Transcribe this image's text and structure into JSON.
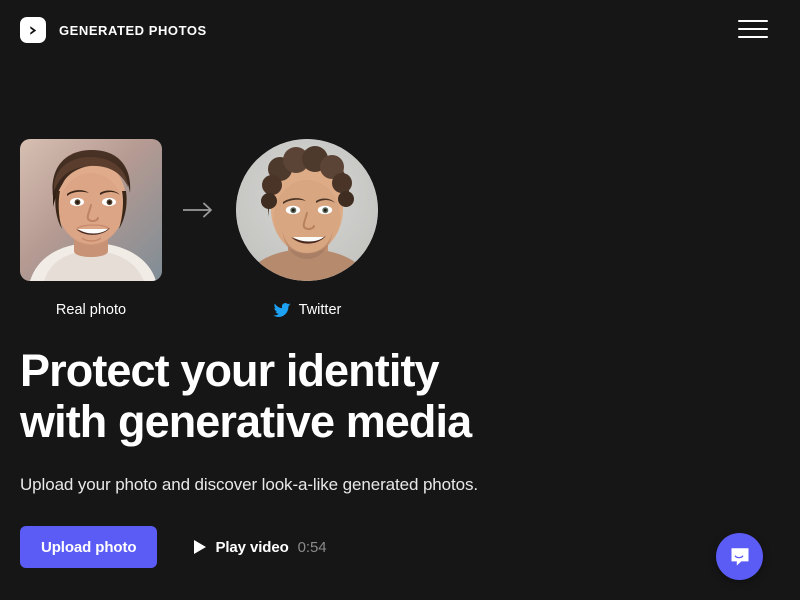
{
  "page": {
    "background_color": "#161616",
    "accent_color": "#5b5bf5",
    "twitter_color": "#1da1f2"
  },
  "header": {
    "logo_icon": "chevron-right-logo-icon",
    "brand_name": "GENERATED PHOTOS",
    "menu_icon": "hamburger-menu-icon"
  },
  "compare": {
    "real": {
      "label": "Real photo",
      "image_alt": "real-photo-portrait"
    },
    "arrow_icon": "arrow-right-icon",
    "generated": {
      "label": "Twitter",
      "platform_icon": "twitter-bird-icon",
      "image_alt": "generated-photo-portrait"
    }
  },
  "hero": {
    "headline": "Protect your identity\nwith generative media",
    "subheadline": "Upload your photo and discover look-a-like generated photos."
  },
  "cta": {
    "upload_label": "Upload photo",
    "play_icon": "play-triangle-icon",
    "play_label": "Play video",
    "play_duration": "0:54"
  },
  "widgets": {
    "intercom_icon": "chat-bubble-icon"
  },
  "scrollbar": {
    "up_icon": "scroll-up-arrow-icon",
    "down_icon": "scroll-down-arrow-icon"
  }
}
